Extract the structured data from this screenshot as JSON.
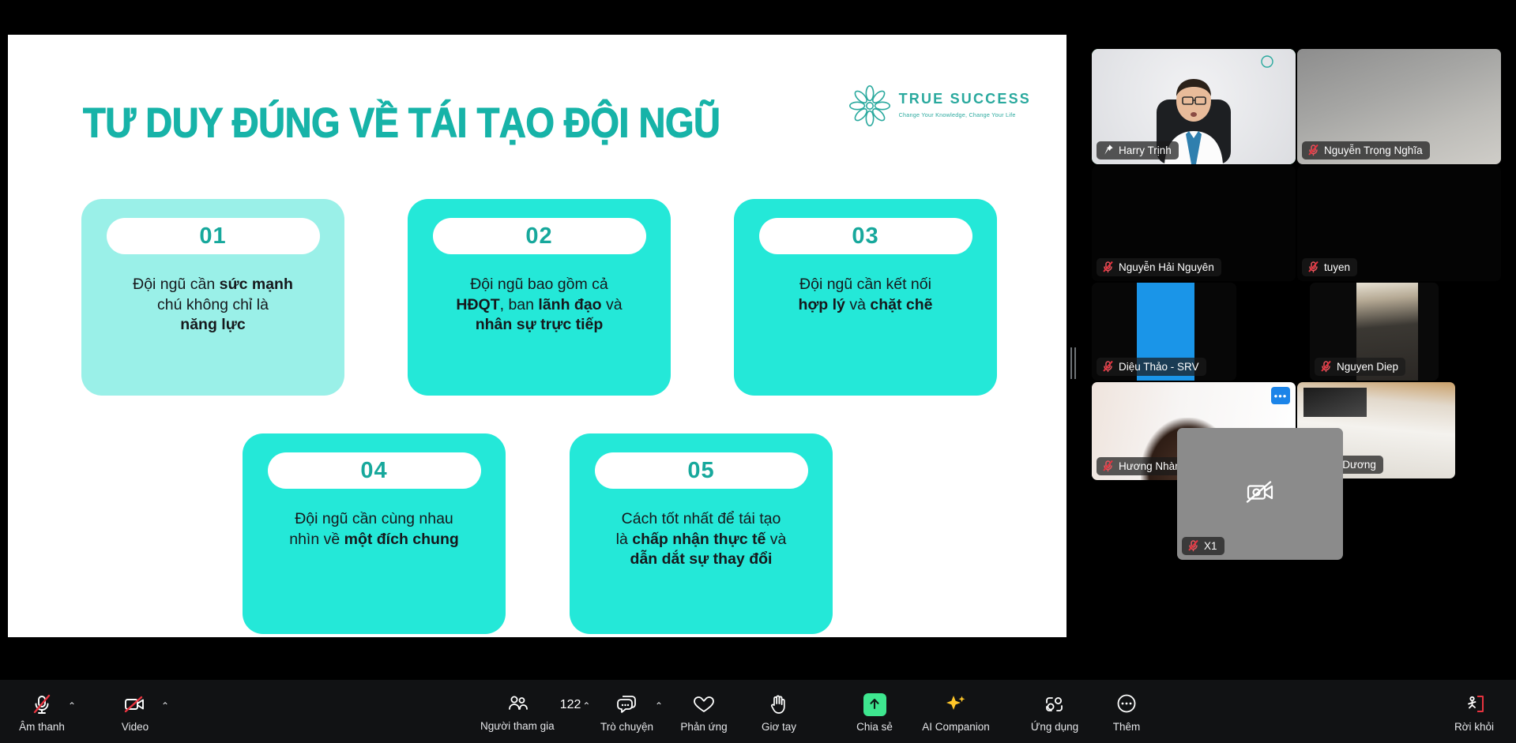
{
  "slide": {
    "title": "TƯ DUY ĐÚNG VỀ TÁI TẠO ĐỘI NGŨ",
    "logo": {
      "name": "TRUE SUCCESS",
      "tagline": "Change Your Knowledge, Change Your Life",
      "mark_icon": "flower-mark-icon",
      "color": "#2aa99e"
    },
    "accent_colors": {
      "title_teal": "#17b3a8",
      "card_light": "#9af0e8",
      "card_bright": "#24e8d8",
      "number_teal": "#17a89c"
    },
    "cards": [
      {
        "number": "01",
        "tone": "light",
        "lines": [
          [
            {
              "t": "Đội ngũ cần ",
              "b": false
            },
            {
              "t": "sức mạnh",
              "b": true
            }
          ],
          [
            {
              "t": "chú không chỉ là",
              "b": false
            }
          ],
          [
            {
              "t": "năng lực",
              "b": true
            }
          ]
        ]
      },
      {
        "number": "02",
        "tone": "bright",
        "lines": [
          [
            {
              "t": "Đội ngũ bao gồm cả",
              "b": false
            }
          ],
          [
            {
              "t": "HĐQT",
              "b": true
            },
            {
              "t": ", ban ",
              "b": false
            },
            {
              "t": "lãnh đạo",
              "b": true
            },
            {
              "t": " và",
              "b": false
            }
          ],
          [
            {
              "t": "nhân sự trực tiếp",
              "b": true
            }
          ]
        ]
      },
      {
        "number": "03",
        "tone": "bright",
        "lines": [
          [
            {
              "t": "Đội ngũ cần kết nối",
              "b": false
            }
          ],
          [
            {
              "t": "hợp lý",
              "b": true
            },
            {
              "t": " và ",
              "b": false
            },
            {
              "t": "chặt chẽ",
              "b": true
            }
          ]
        ]
      },
      {
        "number": "04",
        "tone": "bright",
        "lines": [
          [
            {
              "t": "Đội ngũ cần cùng nhau",
              "b": false
            }
          ],
          [
            {
              "t": "nhìn về ",
              "b": false
            },
            {
              "t": "một đích chung",
              "b": true
            }
          ]
        ]
      },
      {
        "number": "05",
        "tone": "bright",
        "lines": [
          [
            {
              "t": "Cách tốt nhất để tái tạo",
              "b": false
            }
          ],
          [
            {
              "t": "là ",
              "b": false
            },
            {
              "t": "chấp nhận thực tế",
              "b": true
            },
            {
              "t": " và",
              "b": false
            }
          ],
          [
            {
              "t": "dẫn dắt sự thay đổi",
              "b": true
            }
          ]
        ]
      }
    ]
  },
  "gallery": {
    "drag_handle_icon": "vertical-drag-handle-icon",
    "tiles": [
      {
        "name": "Harry Trịnh",
        "status_icon": "pin-icon",
        "active_speaker": true,
        "video_on": true,
        "bg": "bg-harry",
        "more_button": false,
        "camera_off_center": false
      },
      {
        "name": "Nguyễn Trọng Nghĩa",
        "status_icon": "mic-muted-icon",
        "active_speaker": false,
        "video_on": true,
        "bg": "bg-grey",
        "more_button": false,
        "camera_off_center": false
      },
      {
        "name": "Nguyễn Hải Nguyên",
        "status_icon": "mic-muted-icon",
        "active_speaker": false,
        "video_on": false,
        "bg": "bg-black",
        "more_button": false,
        "camera_off_center": false
      },
      {
        "name": "tuyen",
        "status_icon": "mic-muted-icon",
        "active_speaker": false,
        "video_on": false,
        "bg": "bg-black",
        "more_button": false,
        "camera_off_center": false
      },
      {
        "name": "Diệu Thảo - SRV",
        "status_icon": "mic-muted-icon",
        "active_speaker": false,
        "video_on": true,
        "bg": "bg-blue",
        "more_button": false,
        "camera_off_center": false
      },
      {
        "name": "Nguyen Diep",
        "status_icon": "mic-muted-icon",
        "active_speaker": false,
        "video_on": true,
        "bg": "bg-room",
        "more_button": false,
        "camera_off_center": false
      },
      {
        "name": "Hương Nhàn ( CM _ Vĩnh Phúc)",
        "status_icon": "mic-muted-icon",
        "active_speaker": false,
        "video_on": true,
        "bg": "bg-girl",
        "more_button": true,
        "more_label": "•••",
        "camera_off_center": false
      },
      {
        "name": "Bùi Dương",
        "status_icon": "mic-muted-icon",
        "active_speaker": false,
        "video_on": true,
        "bg": "bg-ceil",
        "more_button": false,
        "camera_off_center": false
      },
      {
        "name": "X1",
        "status_icon": "mic-muted-icon",
        "active_speaker": false,
        "video_on": false,
        "bg": "bg-flat",
        "more_button": false,
        "camera_off_center": true,
        "camera_off_icon": "camera-off-icon"
      }
    ]
  },
  "toolbar": {
    "audio": {
      "label": "Âm thanh",
      "icon": "mic-muted-icon",
      "caret": "⌃"
    },
    "video": {
      "label": "Video",
      "icon": "camera-off-icon",
      "caret": "⌃"
    },
    "participants": {
      "label": "Người tham gia",
      "icon": "participants-icon",
      "count": "122",
      "caret": "⌃"
    },
    "chat": {
      "label": "Trò chuyện",
      "icon": "chat-icon",
      "caret": "⌃"
    },
    "reactions": {
      "label": "Phản ứng",
      "icon": "heart-icon"
    },
    "raise_hand": {
      "label": "Giơ tay",
      "icon": "hand-icon"
    },
    "share": {
      "label": "Chia sẻ",
      "icon": "share-screen-icon",
      "color": "#3ee68f"
    },
    "ai_companion": {
      "label": "AI Companion",
      "icon": "sparkle-icon",
      "color": "#ffc629"
    },
    "apps": {
      "label": "Ứng dụng",
      "icon": "apps-icon"
    },
    "more": {
      "label": "Thêm",
      "icon": "ellipsis-circle-icon"
    },
    "leave": {
      "label": "Rời khỏi",
      "icon": "leave-door-icon",
      "color": "#e8333f"
    }
  }
}
